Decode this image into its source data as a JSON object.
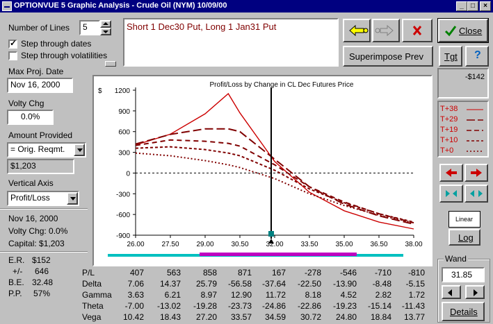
{
  "window": {
    "title": "OPTIONVUE 5 Graphic Analysis - Crude Oil (NYM)  10/09/00"
  },
  "left": {
    "num_lines_label": "Number of Lines",
    "num_lines_value": "5",
    "step_dates_label": "Step through dates",
    "step_dates_checked": true,
    "step_vols_label": "Step through volatilities",
    "step_vols_checked": false,
    "max_proj_label": "Max Proj. Date",
    "max_proj_value": "Nov 16, 2000",
    "volty_label": "Volty Chg",
    "volty_value": "0.0%",
    "amount_label": "Amount Provided",
    "amount_value": "= Orig. Reqmt.",
    "amount_readout": "$1,203",
    "vaxis_label": "Vertical Axis",
    "vaxis_value": "Profit/Loss",
    "info_date": "Nov 16, 2000",
    "info_volty": "Volty Chg:  0.0%",
    "info_capital": "Capital:  $1,203",
    "er_label": "E.R.",
    "er_value": "$152",
    "pm_label": "+/-",
    "pm_value": "646",
    "be_label": "B.E.",
    "be_value": "32.48",
    "pp_label": "P.P.",
    "pp_value": "57%"
  },
  "position_text": "Short 1 Dec30 Put, Long 1 Jan31 Put",
  "buttons": {
    "close": "Close",
    "superimpose": "Superimpose Prev",
    "tgt": "Tgt",
    "help": "?",
    "linear": "Linear",
    "log": "Log",
    "details": "Details"
  },
  "right": {
    "readout": "-$142",
    "legend": [
      "T+38",
      "T+29",
      "T+19",
      "T+10",
      "T+0"
    ],
    "wand_label": "Wand",
    "wand_value": "31.85"
  },
  "chart_data": {
    "type": "line",
    "title": "Profit/Loss by Change in CL Dec Futures Price",
    "ylabel": "$",
    "xlabel": "",
    "x_ticks": [
      "26.00",
      "27.50",
      "29.00",
      "30.50",
      "32.00",
      "33.50",
      "35.00",
      "36.50",
      "38.00"
    ],
    "y_ticks": [
      "1200",
      "900",
      "600",
      "300",
      "0",
      "-300",
      "-600",
      "-900"
    ],
    "xlim": [
      26,
      38
    ],
    "ylim": [
      -900,
      1200
    ],
    "cursor_x": 31.85,
    "grid": false,
    "legend_position": "right-panel",
    "colors": {
      "line": "#cc0000",
      "dark": "#800000",
      "cursor": "#000000",
      "zero": "#000000"
    },
    "series": [
      {
        "name": "T+38",
        "x": [
          26.0,
          27.5,
          29.0,
          30.0,
          30.5,
          32.0,
          33.5,
          35.0,
          36.5,
          38.0
        ],
        "values": [
          407,
          563,
          858,
          1150,
          871,
          167,
          -278,
          -546,
          -710,
          -810
        ]
      },
      {
        "name": "T+29",
        "x": [
          26.0,
          27.5,
          29.0,
          30.0,
          30.5,
          32.0,
          33.5,
          35.0,
          36.5,
          38.0
        ],
        "values": [
          420,
          560,
          640,
          640,
          600,
          200,
          -200,
          -450,
          -620,
          -740
        ]
      },
      {
        "name": "T+19",
        "x": [
          26.0,
          27.5,
          29.0,
          30.0,
          30.5,
          32.0,
          33.5,
          35.0,
          36.5,
          38.0
        ],
        "values": [
          400,
          480,
          460,
          430,
          390,
          120,
          -200,
          -420,
          -590,
          -720
        ]
      },
      {
        "name": "T+10",
        "x": [
          26.0,
          27.5,
          29.0,
          30.0,
          30.5,
          32.0,
          33.5,
          35.0,
          36.5,
          38.0
        ],
        "values": [
          360,
          380,
          340,
          290,
          250,
          40,
          -230,
          -430,
          -590,
          -710
        ]
      },
      {
        "name": "T+0",
        "x": [
          26.0,
          27.5,
          29.0,
          30.0,
          30.5,
          32.0,
          33.5,
          35.0,
          36.5,
          38.0
        ],
        "values": [
          290,
          250,
          180,
          120,
          80,
          -80,
          -300,
          -470,
          -610,
          -720
        ]
      }
    ]
  },
  "table": {
    "rows": [
      {
        "label": "P/L",
        "values": [
          "407",
          "563",
          "858",
          "871",
          "167",
          "-278",
          "-546",
          "-710",
          "-810"
        ]
      },
      {
        "label": "Delta",
        "values": [
          "7.06",
          "14.37",
          "25.79",
          "-56.58",
          "-37.64",
          "-22.50",
          "-13.90",
          "-8.48",
          "-5.15"
        ]
      },
      {
        "label": "Gamma",
        "values": [
          "3.63",
          "6.21",
          "8.97",
          "12.90",
          "11.72",
          "8.18",
          "4.52",
          "2.82",
          "1.72"
        ]
      },
      {
        "label": "Theta",
        "values": [
          "-7.00",
          "-13.02",
          "-19.28",
          "-23.73",
          "-24.86",
          "-22.86",
          "-19.23",
          "-15.14",
          "-11.43"
        ]
      },
      {
        "label": "Vega",
        "values": [
          "10.42",
          "18.43",
          "27.20",
          "33.57",
          "34.59",
          "30.72",
          "24.80",
          "18.84",
          "13.77"
        ]
      }
    ]
  }
}
